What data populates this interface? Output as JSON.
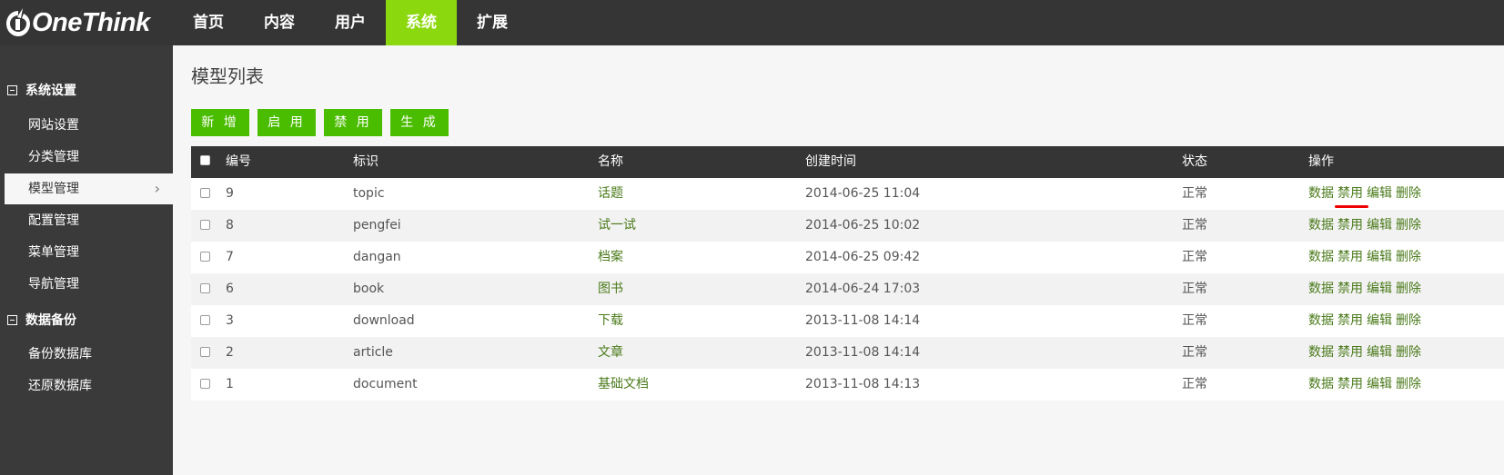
{
  "app": {
    "logo_text": "OneThink"
  },
  "nav": {
    "items": [
      {
        "label": "首页"
      },
      {
        "label": "内容"
      },
      {
        "label": "用户"
      },
      {
        "label": "系统",
        "active": true
      },
      {
        "label": "扩展"
      }
    ]
  },
  "sidebar": {
    "groups": [
      {
        "label": "系统设置",
        "items": [
          {
            "label": "网站设置"
          },
          {
            "label": "分类管理"
          },
          {
            "label": "模型管理",
            "active": true
          },
          {
            "label": "配置管理"
          },
          {
            "label": "菜单管理"
          },
          {
            "label": "导航管理"
          }
        ]
      },
      {
        "label": "数据备份",
        "items": [
          {
            "label": "备份数据库"
          },
          {
            "label": "还原数据库"
          }
        ]
      }
    ]
  },
  "main": {
    "title": "模型列表",
    "buttons": {
      "add": "新 增",
      "enable": "启 用",
      "disable": "禁 用",
      "generate": "生 成"
    }
  },
  "table": {
    "headers": {
      "id": "编号",
      "key": "标识",
      "name": "名称",
      "created": "创建时间",
      "status": "状态",
      "ops": "操作"
    },
    "rows": [
      {
        "id": "9",
        "key": "topic",
        "name": "话题",
        "created": "2014-06-25 11:04",
        "status": "正常"
      },
      {
        "id": "8",
        "key": "pengfei",
        "name": "试一试",
        "created": "2014-06-25 10:02",
        "status": "正常"
      },
      {
        "id": "7",
        "key": "dangan",
        "name": "档案",
        "created": "2014-06-25 09:42",
        "status": "正常"
      },
      {
        "id": "6",
        "key": "book",
        "name": "图书",
        "created": "2014-06-24 17:03",
        "status": "正常"
      },
      {
        "id": "3",
        "key": "download",
        "name": "下载",
        "created": "2013-11-08 14:14",
        "status": "正常"
      },
      {
        "id": "2",
        "key": "article",
        "name": "文章",
        "created": "2013-11-08 14:14",
        "status": "正常"
      },
      {
        "id": "1",
        "key": "document",
        "name": "基础文档",
        "created": "2013-11-08 14:13",
        "status": "正常"
      }
    ],
    "row_actions": {
      "data": "数据",
      "disable": "禁用",
      "edit": "编辑",
      "delete": "删除"
    }
  },
  "colors": {
    "topbar": "#353535",
    "nav_active": "#8cd80e",
    "sidebar": "#3a3a3a",
    "button": "#4bbd00",
    "link": "#4a7a1a",
    "annotation": "#e00000"
  }
}
